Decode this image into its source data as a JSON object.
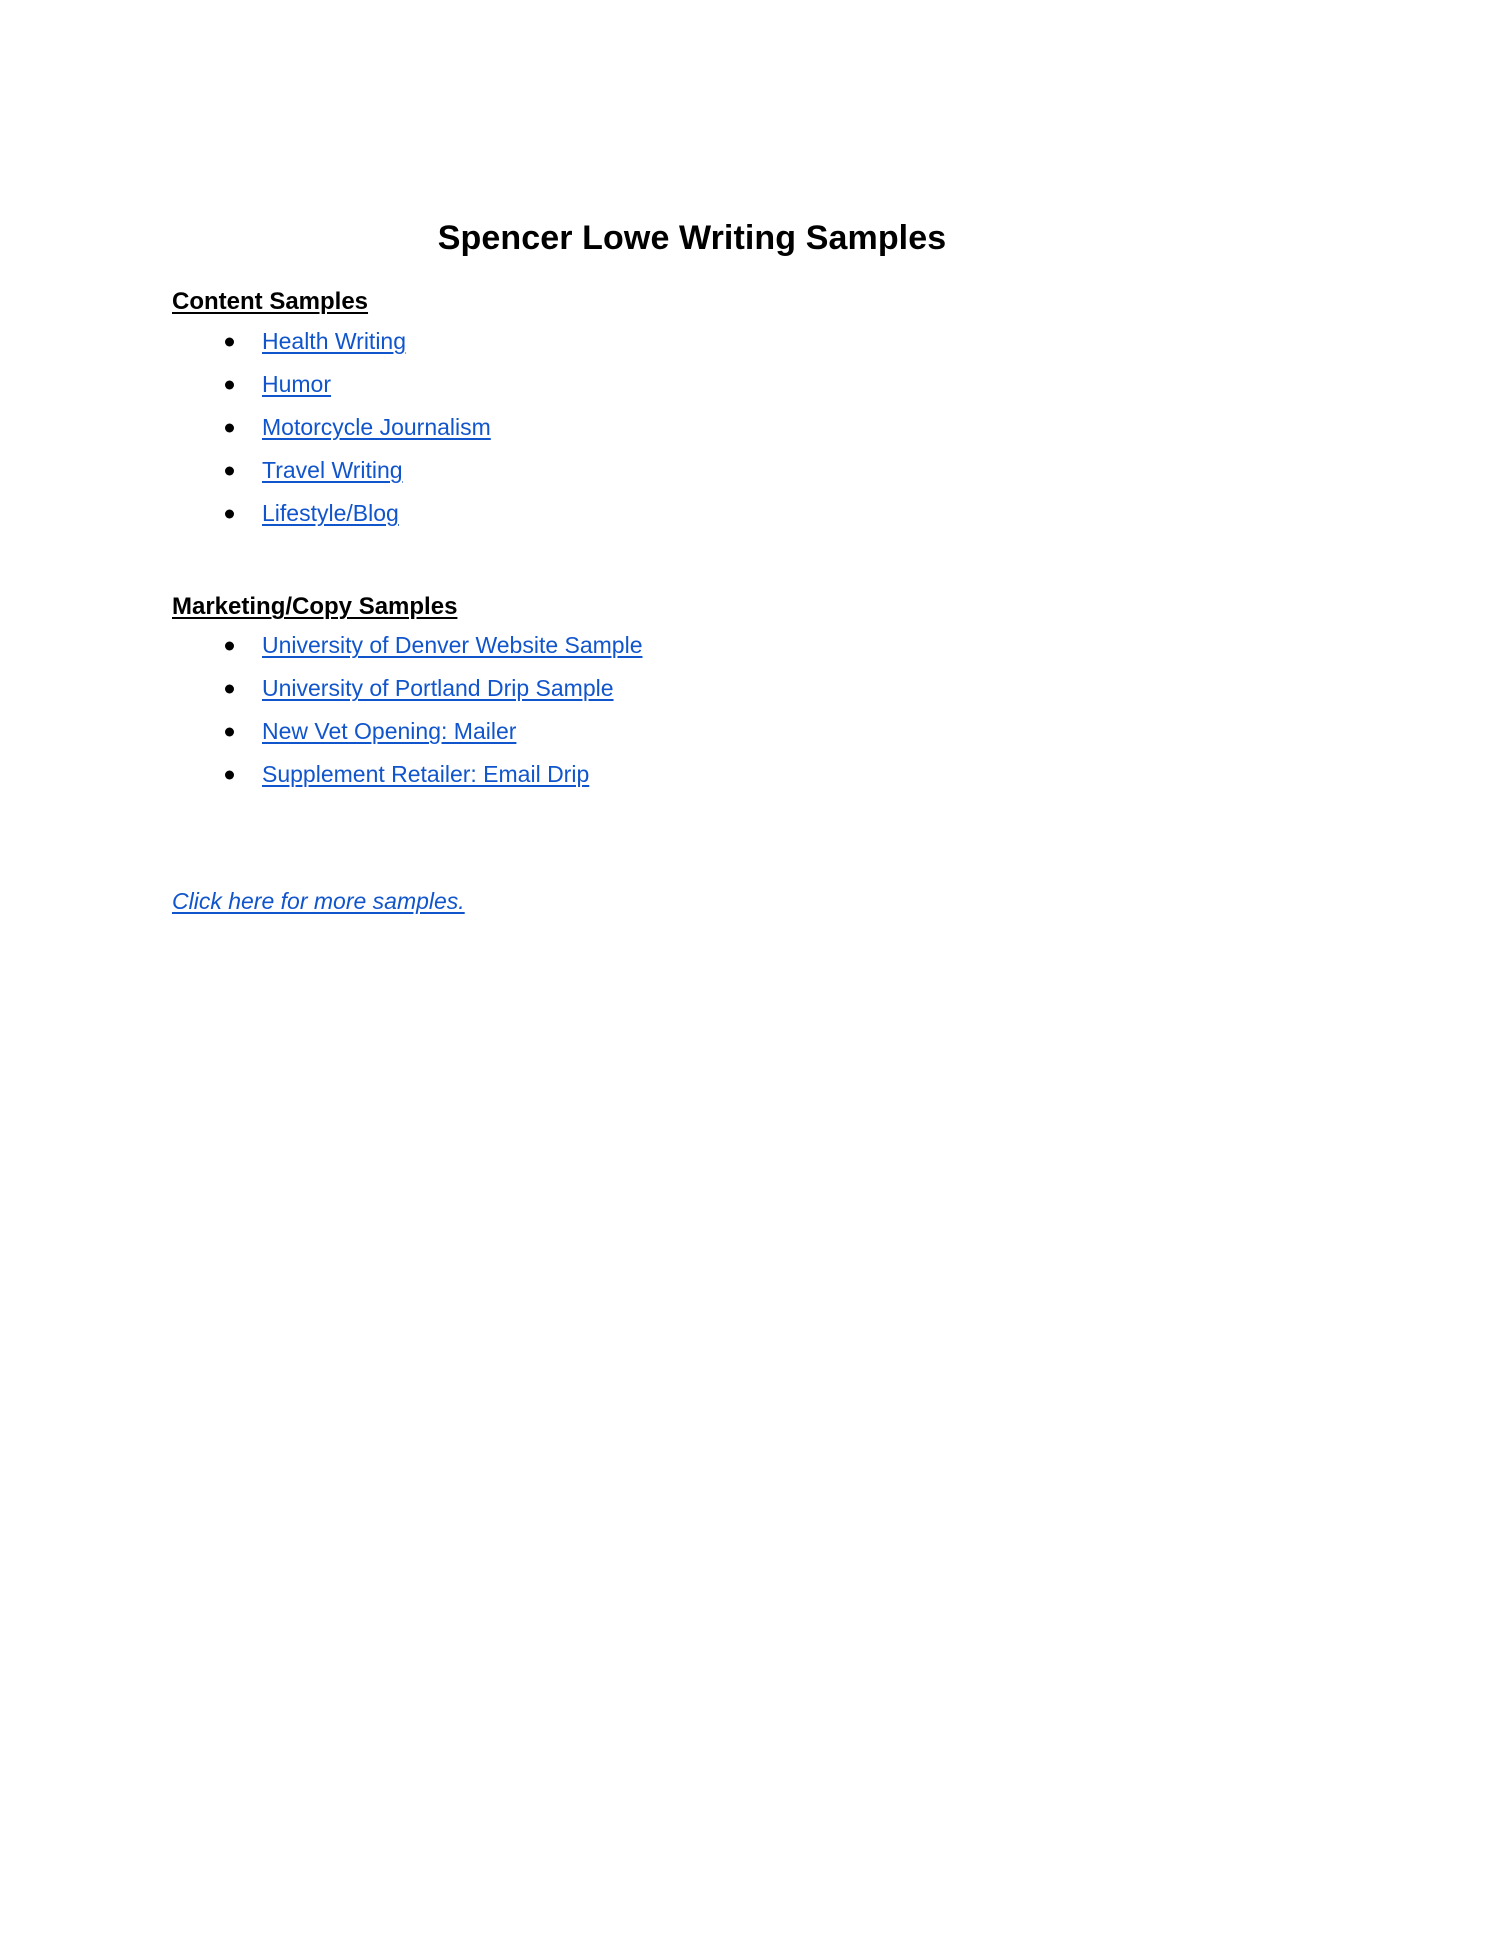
{
  "document": {
    "title": "Spencer Lowe Writing Samples",
    "background_color": "#ffffff",
    "text_color": "#000000",
    "link_color": "#1155cc"
  },
  "sections": [
    {
      "heading": "Content Samples",
      "items": [
        {
          "label": "Health Writing"
        },
        {
          "label": "Humor"
        },
        {
          "label": "Motorcycle Journalism"
        },
        {
          "label": "Travel Writing"
        },
        {
          "label": "Lifestyle/Blog"
        }
      ]
    },
    {
      "heading": "Marketing/Copy Samples",
      "items": [
        {
          "label": "University of Denver Website Sample"
        },
        {
          "label": "University of Portland Drip Sample"
        },
        {
          "label": "New Vet Opening: Mailer"
        },
        {
          "label": "Supplement Retailer: Email Drip"
        }
      ]
    }
  ],
  "footer": {
    "link_label": "Click here for more samples."
  }
}
